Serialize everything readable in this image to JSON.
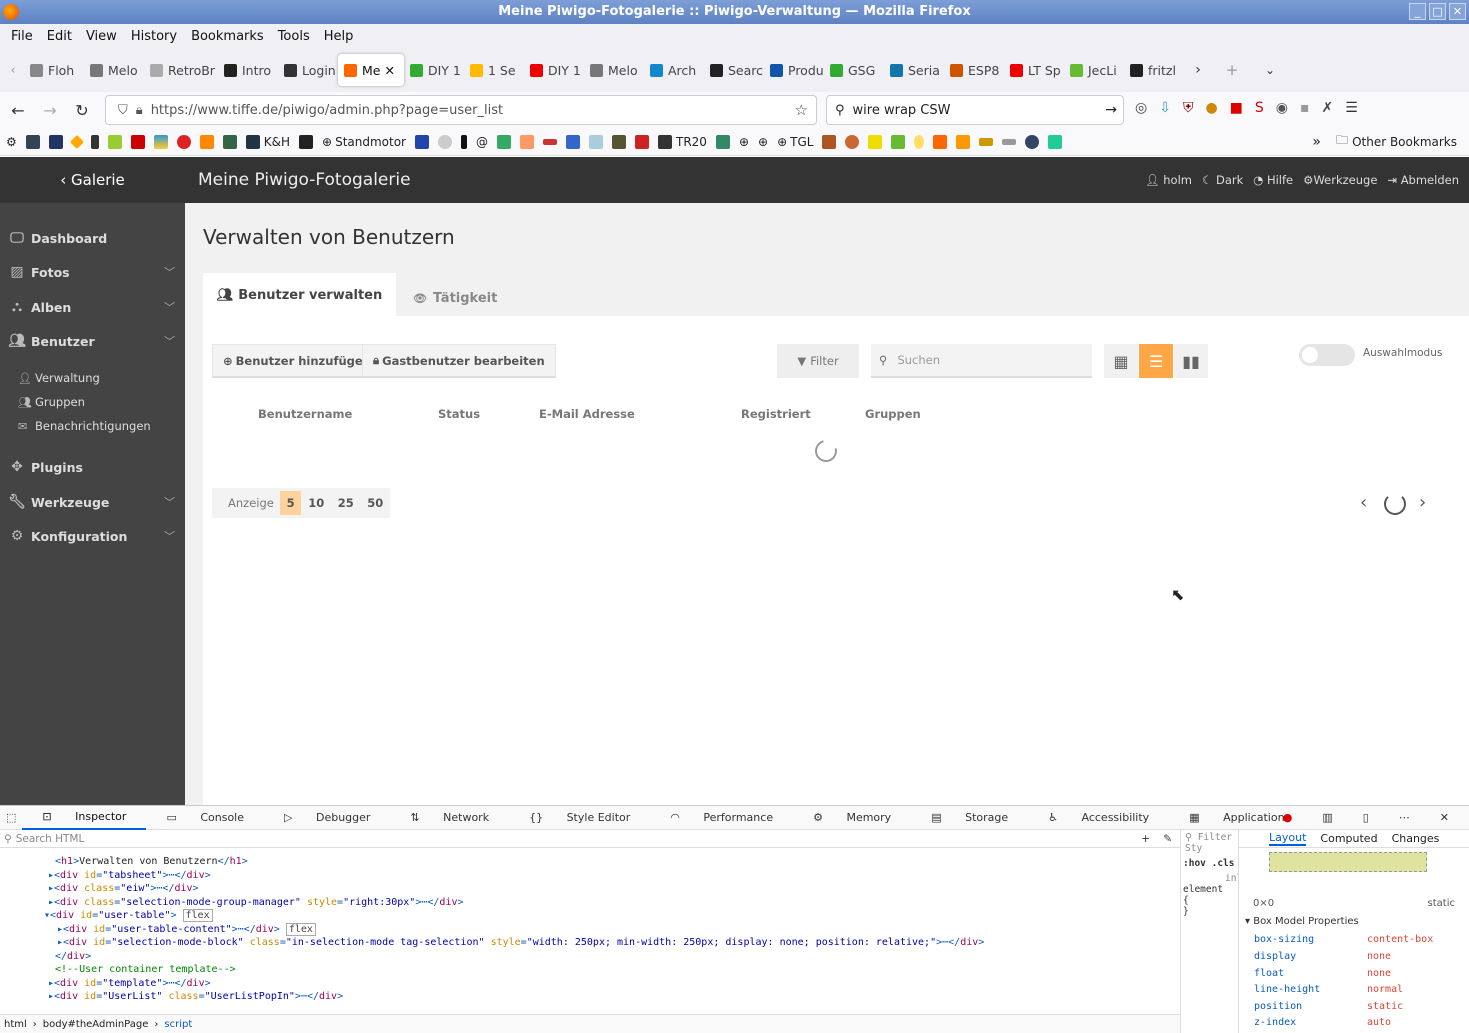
{
  "window": {
    "title": "Meine Piwigo-Fotogalerie :: Piwigo-Verwaltung — Mozilla Firefox"
  },
  "menu": [
    "File",
    "Edit",
    "View",
    "History",
    "Bookmarks",
    "Tools",
    "Help"
  ],
  "tabs": [
    {
      "label": "Floh",
      "color": "#888"
    },
    {
      "label": "Melo",
      "color": "#777"
    },
    {
      "label": "RetroBr",
      "color": "#aaa"
    },
    {
      "label": "Intro",
      "color": "#222"
    },
    {
      "label": "Login",
      "color": "#333"
    },
    {
      "label": "Me",
      "color": "#f60",
      "active": true
    },
    {
      "label": "DIY 1",
      "color": "#3a3"
    },
    {
      "label": "1  Se",
      "color": "#fb0"
    },
    {
      "label": "DIY 1",
      "color": "#e00"
    },
    {
      "label": "Melo",
      "color": "#777"
    },
    {
      "label": "Arch",
      "color": "#18c"
    },
    {
      "label": "Searc",
      "color": "#222"
    },
    {
      "label": "Produ",
      "color": "#15a"
    },
    {
      "label": "GSG",
      "color": "#3a3"
    },
    {
      "label": "Seria",
      "color": "#17a"
    },
    {
      "label": "ESP8",
      "color": "#c50"
    },
    {
      "label": "LT Sp",
      "color": "#e00"
    },
    {
      "label": "JecLi",
      "color": "#6b3"
    },
    {
      "label": "fritzl",
      "color": "#222"
    }
  ],
  "nav": {
    "url": "https://www.tiffe.de/piwigo/admin.php?page=user_list",
    "search": "wire wrap CSW"
  },
  "bookmarks": {
    "items": [
      "K&H",
      "Standmotor",
      "TR20",
      "TGL"
    ],
    "other": "Other Bookmarks"
  },
  "header": {
    "galerie": "Galerie",
    "site_title": "Meine Piwigo-Fotogalerie",
    "links": [
      "holm",
      "Dark",
      "Hilfe",
      "Werkzeuge",
      "Abmelden"
    ]
  },
  "sidebar": {
    "items": [
      "Dashboard",
      "Fotos",
      "Alben",
      "Benutzer",
      "Plugins",
      "Werkzeuge",
      "Konfiguration"
    ],
    "subs": [
      "Verwaltung",
      "Gruppen",
      "Benachrichtigungen"
    ]
  },
  "main": {
    "title": "Verwalten von Benutzern",
    "tab_active": "Benutzer verwalten",
    "tab_other": "Tätigkeit",
    "add_user": "Benutzer hinzufügen",
    "guest": "Gastbenutzer bearbeiten",
    "filter": "Filter",
    "search_placeholder": "Suchen",
    "selection_mode": "Auswahlmodus",
    "columns": [
      "Benutzername",
      "Status",
      "E-Mail Adresse",
      "Registriert",
      "Gruppen"
    ],
    "pager_label": "Anzeige",
    "page_sizes": [
      "5",
      "10",
      "25",
      "50"
    ],
    "page_size_selected": "5"
  },
  "devtools": {
    "tabs": [
      "Inspector",
      "Console",
      "Debugger",
      "Network",
      "Style Editor",
      "Performance",
      "Memory",
      "Storage",
      "Accessibility",
      "Application"
    ],
    "search_placeholder": "Search HTML",
    "breadcrumb": [
      "html",
      "body#theAdminPage",
      "script"
    ],
    "layout_tabs": [
      "Layout",
      "Computed",
      "Changes"
    ],
    "box_section": "Box Model Properties",
    "box_size": "0×0",
    "box_position": "static",
    "props": [
      [
        "box-sizing",
        "content-box"
      ],
      [
        "display",
        "none"
      ],
      [
        "float",
        "none"
      ],
      [
        "line-height",
        "normal"
      ],
      [
        "position",
        "static"
      ],
      [
        "z-index",
        "auto"
      ]
    ],
    "filter_styles": "Filter Sty",
    "hov_cls": ":hov .cls",
    "element_label": "element",
    "inline_label": "inli"
  }
}
